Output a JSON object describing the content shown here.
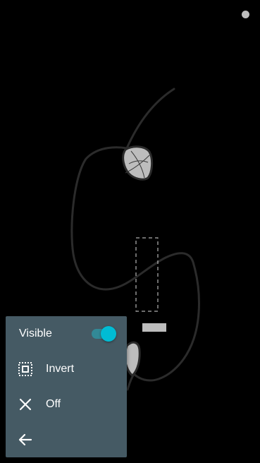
{
  "menu": {
    "visible_label": "Visible",
    "visible_on": true,
    "invert_label": "Invert",
    "off_label": "Off"
  },
  "icons": {
    "invert": "select-invert-icon",
    "off": "close-icon",
    "back": "arrow-back-icon"
  },
  "colors": {
    "menu_background": "#455a64",
    "toggle_accent": "#00bcd4",
    "canvas_background": "#000000",
    "stroke": "#2b2b2b",
    "fill_gray": "#bdbdbd"
  }
}
